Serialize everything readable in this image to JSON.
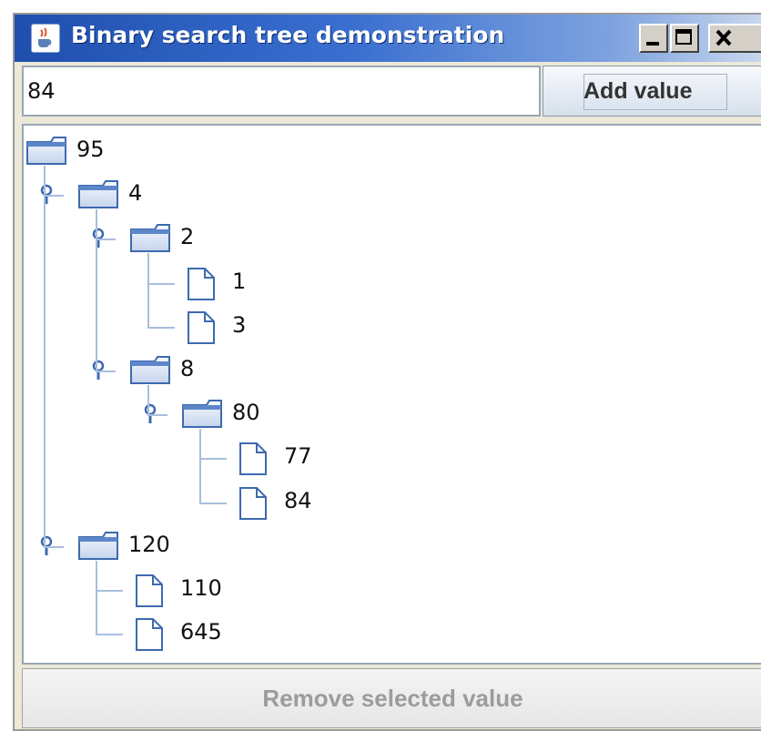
{
  "window": {
    "title": "Binary search tree demonstration",
    "icons": {
      "app": "java-cup-icon",
      "minimize": "minimize-icon",
      "maximize": "maximize-icon",
      "close": "close-icon"
    }
  },
  "toolbar": {
    "input_value": "84",
    "add_label": "Add value"
  },
  "tree": {
    "nodes": [
      {
        "label": "95",
        "type": "folder",
        "expanded": true
      },
      {
        "label": "4",
        "type": "folder",
        "expanded": true
      },
      {
        "label": "2",
        "type": "folder",
        "expanded": true
      },
      {
        "label": "1",
        "type": "leaf"
      },
      {
        "label": "3",
        "type": "leaf"
      },
      {
        "label": "8",
        "type": "folder",
        "expanded": true
      },
      {
        "label": "80",
        "type": "folder",
        "expanded": true
      },
      {
        "label": "77",
        "type": "leaf"
      },
      {
        "label": "84",
        "type": "leaf"
      },
      {
        "label": "120",
        "type": "folder",
        "expanded": true
      },
      {
        "label": "110",
        "type": "leaf"
      },
      {
        "label": "645",
        "type": "leaf"
      }
    ]
  },
  "footer": {
    "remove_label": "Remove selected value",
    "remove_enabled": false
  },
  "colors": {
    "titlebar_start": "#1f4fae",
    "tree_line": "#a8bede",
    "icon_stroke": "#3d6ab0",
    "disabled_text": "#9c9c9c"
  }
}
